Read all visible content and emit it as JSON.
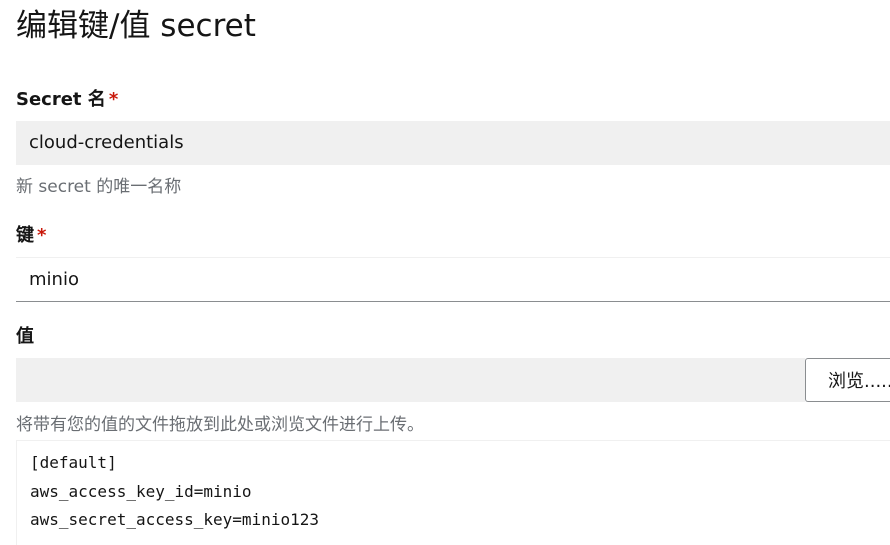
{
  "page": {
    "title": "编辑键/值 secret"
  },
  "secret_name": {
    "label": "Secret 名",
    "required_mark": "*",
    "value": "cloud-credentials",
    "helper": "新 secret 的唯一名称"
  },
  "key": {
    "label": "键",
    "required_mark": "*",
    "value": "minio"
  },
  "value": {
    "label": "值",
    "browse_label": "浏览......",
    "helper": "将带有您的值的文件拖放到此处或浏览文件进行上传。",
    "lines": [
      "[default]",
      "aws_access_key_id=minio",
      "aws_secret_access_key=minio123"
    ]
  },
  "colors": {
    "required": "#c9190b",
    "field_background": "#f0f0f0",
    "helper_text": "#6a6e73"
  }
}
